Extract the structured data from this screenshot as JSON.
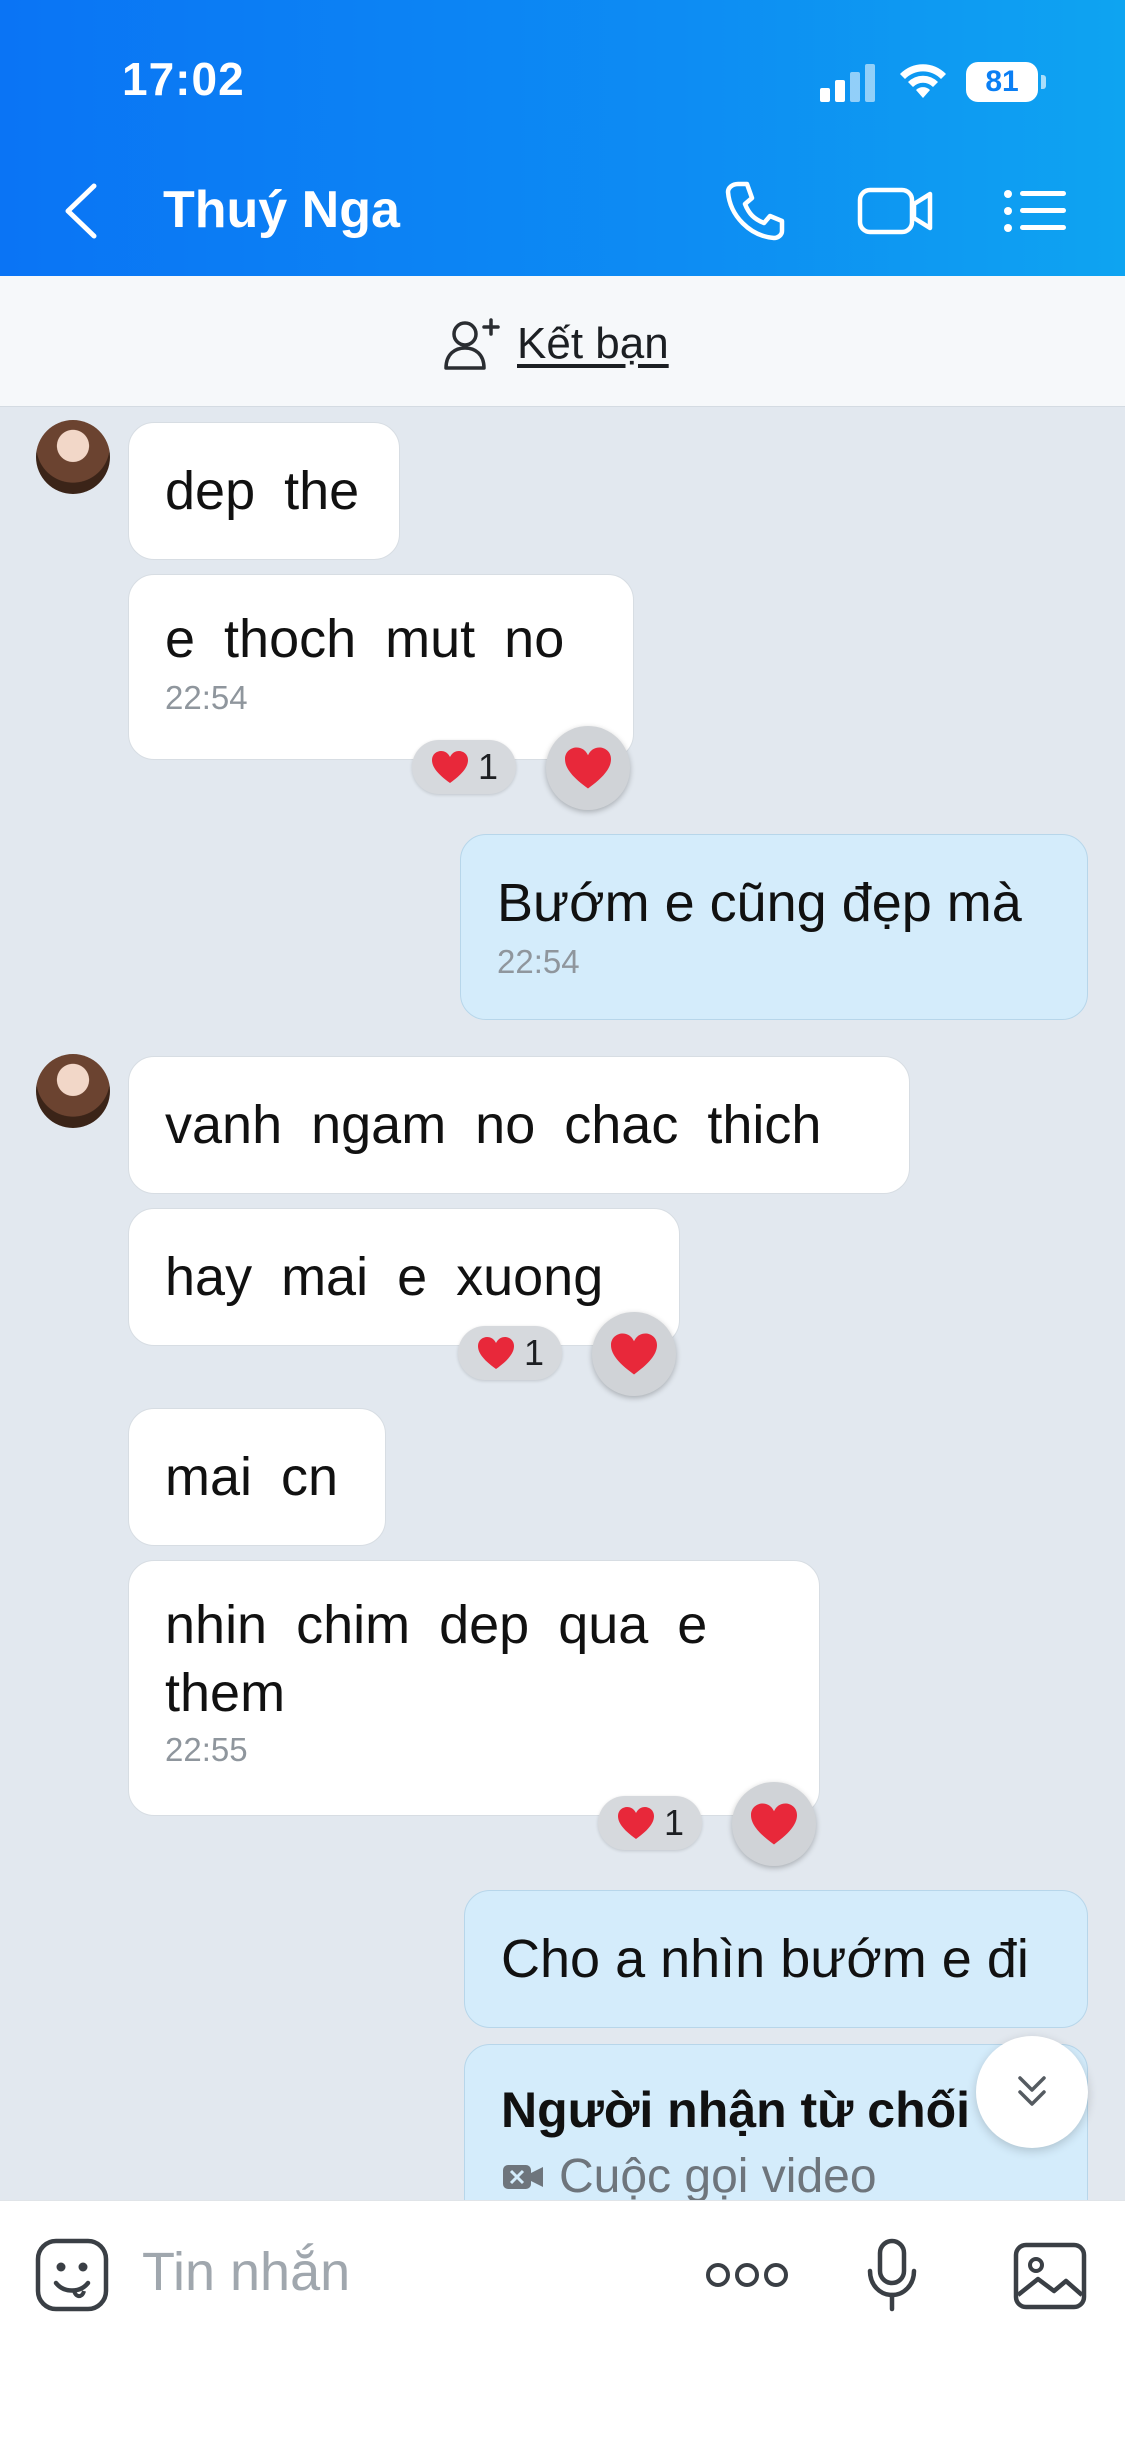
{
  "status_bar": {
    "time": "17:02",
    "battery": "81"
  },
  "header": {
    "title": "Thuý Nga"
  },
  "friend_bar": {
    "label": "Kết bạn"
  },
  "messages": [
    {
      "text": "dep the"
    },
    {
      "text": "e thoch mut no",
      "time": "22:54",
      "reaction_count": "1"
    },
    {
      "text": "Bướm e cũng đẹp mà",
      "time": "22:54"
    },
    {
      "text": "vanh ngam no chac thich"
    },
    {
      "text": "hay mai e xuong",
      "reaction_count": "1"
    },
    {
      "text": "mai cn"
    },
    {
      "text": "nhin chim dep qua e them",
      "time": "22:55",
      "reaction_count": "1"
    },
    {
      "text": "Cho a nhìn bướm e đi"
    },
    {
      "title": "Người nhận từ chối",
      "subtitle": "Cuộc gọi video"
    }
  ],
  "input": {
    "placeholder": "Tin nhắn"
  },
  "colors": {
    "header_blue": "#0b7ff4",
    "outgoing_bubble": "#d4ecfb",
    "chat_bg": "#e2e8ef",
    "heart": "#e8283a"
  },
  "icons": [
    "back-icon",
    "phone-icon",
    "video-icon",
    "menu-list-icon",
    "add-friend-icon",
    "heart-icon",
    "double-chevron-down-icon",
    "sticker-icon",
    "more-icon",
    "microphone-icon",
    "image-icon",
    "video-call-icon"
  ]
}
